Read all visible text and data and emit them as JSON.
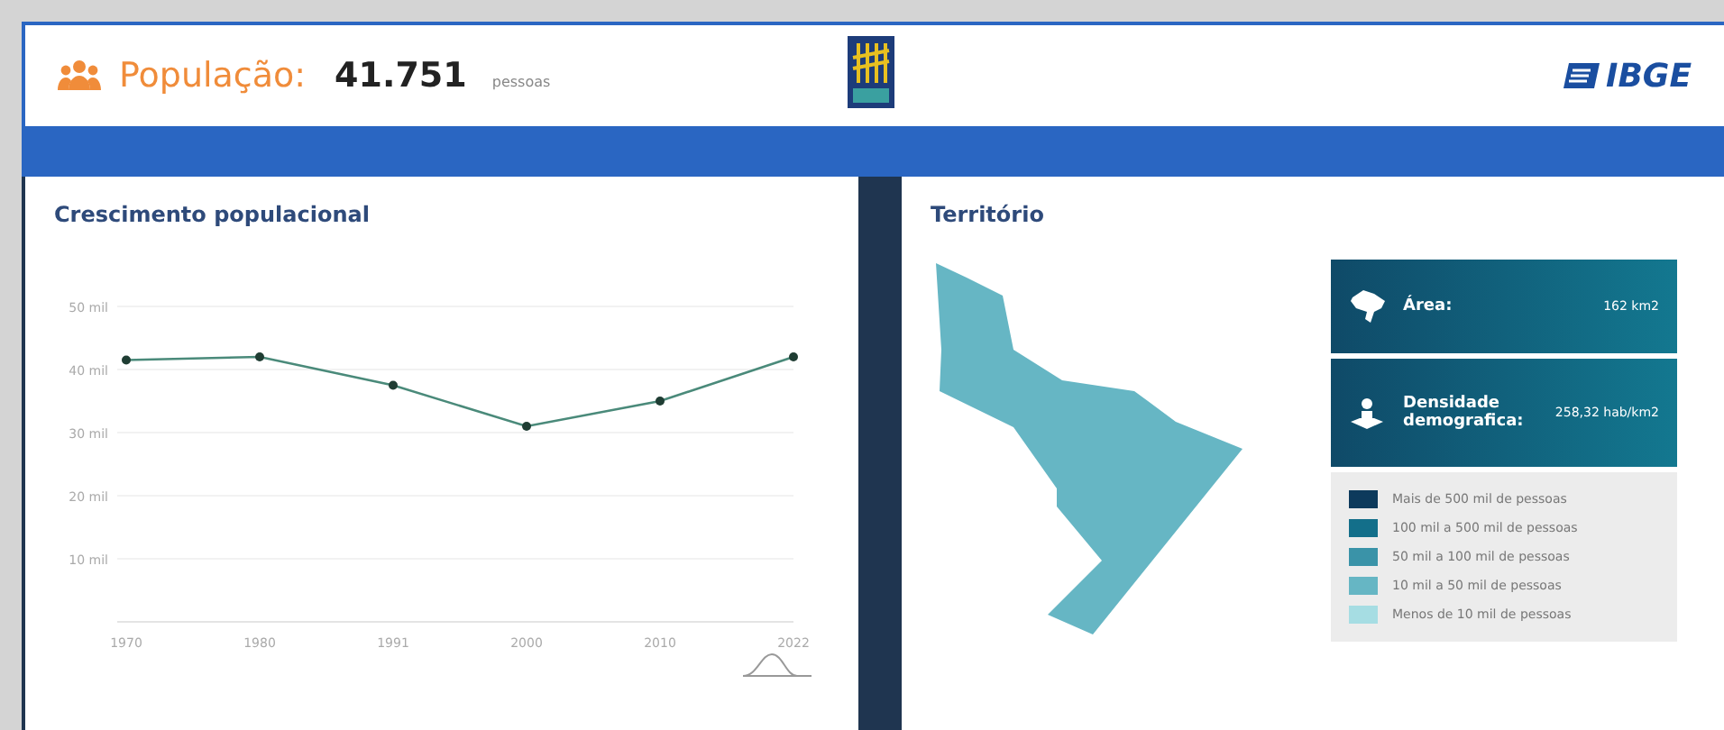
{
  "header": {
    "label": "População:",
    "value": "41.751",
    "unit": "pessoas",
    "brand": "IBGE"
  },
  "growth": {
    "title": "Crescimento populacional",
    "chart_data": {
      "type": "line",
      "categories": [
        "1970",
        "1980",
        "1991",
        "2000",
        "2010",
        "2022"
      ],
      "yticks": [
        {
          "value": 10,
          "label": "10 mil"
        },
        {
          "value": 20,
          "label": "20 mil"
        },
        {
          "value": 30,
          "label": "30 mil"
        },
        {
          "value": 40,
          "label": "40 mil"
        },
        {
          "value": 50,
          "label": "50 mil"
        }
      ],
      "ylim": [
        0,
        50
      ],
      "grid": true,
      "series": [
        {
          "color": "#4a8a7a",
          "marker": true,
          "values": [
            41.5,
            42,
            37.5,
            31,
            35,
            42
          ]
        }
      ]
    }
  },
  "territory": {
    "title": "Território",
    "stats": [
      {
        "kind": "area",
        "label": "Área:",
        "value": "162 km2"
      },
      {
        "kind": "density",
        "label": "Densidade demografica:",
        "value": "258,32 hab/km2"
      }
    ],
    "legend": [
      {
        "label": "Mais de 500 mil de pessoas",
        "color": "#0d3a5c"
      },
      {
        "label": "100 mil a 500 mil de pessoas",
        "color": "#136f8a"
      },
      {
        "label": "50 mil a 100 mil de pessoas",
        "color": "#3a93a8"
      },
      {
        "label": "10 mil a 50 mil de pessoas",
        "color": "#66b6c4"
      },
      {
        "label": "Menos de 10 mil de pessoas",
        "color": "#a6dde3"
      }
    ]
  }
}
